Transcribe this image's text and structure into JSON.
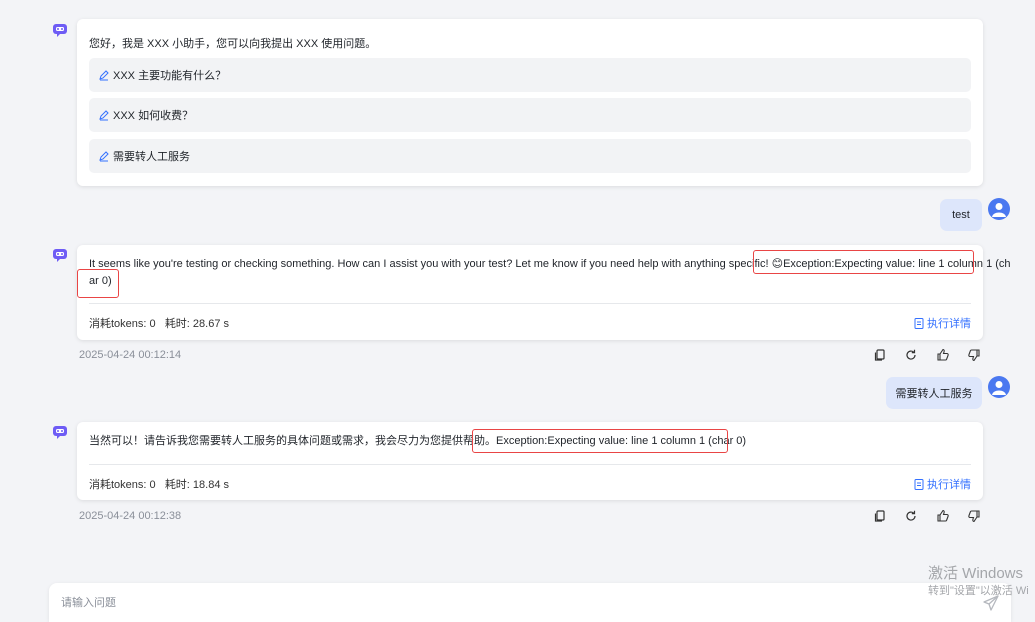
{
  "welcome": {
    "greeting": "您好，我是 XXX 小助手，您可以向我提出 XXX 使用问题。",
    "suggestions": [
      {
        "label": "XXX 主要功能有什么？"
      },
      {
        "label": "XXX 如何收费？"
      },
      {
        "label": "需要转人工服务"
      }
    ]
  },
  "messages": [
    {
      "user_text": "test",
      "bot_text_line1": "It seems like you're testing or checking something. How can I assist you with your test? Let me know if you need help with anything specific! 😊Exception:Expecting value: line 1 column 1 (ch",
      "bot_text_line2": "ar 0)",
      "tokens_label": "消耗tokens: 0",
      "time_label": "耗时: 28.67 s",
      "detail_label": "执行详情",
      "timestamp": "2025-04-24 00:12:14"
    },
    {
      "user_text": "需要转人工服务",
      "bot_text_line1": "当然可以！请告诉我您需要转人工服务的具体问题或需求，我会尽力为您提供帮助。Exception:Expecting value: line 1 column 1 (char 0)",
      "tokens_label": "消耗tokens: 0",
      "time_label": "耗时: 18.84 s",
      "detail_label": "执行详情",
      "timestamp": "2025-04-24 00:12:38"
    }
  ],
  "input": {
    "placeholder": "请输入问题"
  },
  "watermark": {
    "line1": "激活 Windows",
    "line2": "转到\"设置\"以激活 Wi"
  },
  "colors": {
    "accent": "#3370ff",
    "user_bubble": "#dde6fb",
    "error_highlight": "#e94545",
    "avatar_blue": "#4a78f0",
    "bot_icon": "#6e5cf5"
  },
  "icons": {
    "bot_avatar": "robot-icon",
    "user_avatar": "user-icon",
    "suggestion": "pen-icon",
    "detail": "document-icon",
    "actions": [
      "copy-icon",
      "refresh-icon",
      "thumbs-up-icon",
      "thumbs-down-icon"
    ],
    "send": "send-icon"
  }
}
